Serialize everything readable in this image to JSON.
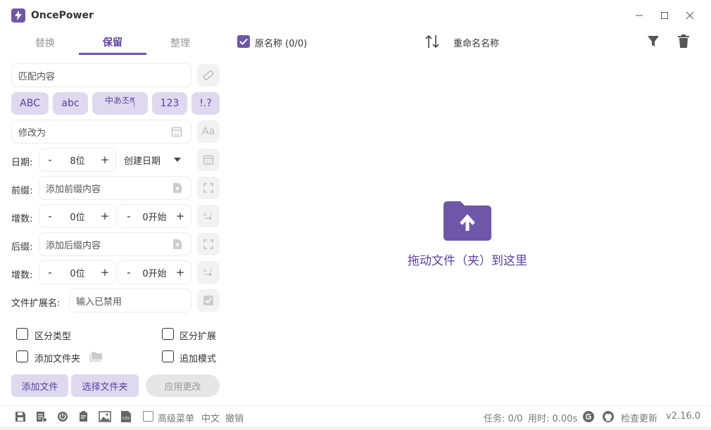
{
  "app": {
    "title": "OncePower",
    "version": "v2.16.0"
  },
  "tabs": [
    {
      "label": "替换",
      "active": false
    },
    {
      "label": "保留",
      "active": true
    },
    {
      "label": "整理",
      "active": false
    }
  ],
  "match": {
    "placeholder": "匹配内容"
  },
  "chips": [
    "ABC",
    "abc",
    "中あ조ན",
    "123",
    "!.?"
  ],
  "modify": {
    "placeholder": "修改为"
  },
  "date": {
    "label": "日期:",
    "digits": "8位",
    "type": "创建日期"
  },
  "prefix": {
    "label": "前缀:",
    "placeholder": "添加前缀内容"
  },
  "prefix_increment": {
    "label": "增数:",
    "digits": "0位",
    "start": "0开始"
  },
  "suffix": {
    "label": "后缀:",
    "placeholder": "添加后缀内容"
  },
  "suffix_increment": {
    "label": "增数:",
    "digits": "0位",
    "start": "0开始"
  },
  "extension": {
    "label": "文件扩展名:",
    "placeholder": "输入已禁用"
  },
  "options": {
    "distinguish_type": "区分类型",
    "distinguish_ext": "区分扩展",
    "add_folder": "添加文件夹",
    "append_mode": "追加模式"
  },
  "buttons": {
    "add_file": "添加文件",
    "select_folder": "选择文件夹",
    "apply": "应用更改"
  },
  "list_header": {
    "original_name": "原名称 (0/0)",
    "rename_name": "重命名名称"
  },
  "drop_zone": {
    "text": "拖动文件（夹）到这里"
  },
  "status": {
    "advanced_menu": "高级菜单",
    "language": "中文",
    "undo": "撤销",
    "tasks": "任务: 0/0",
    "elapsed": "用时: 0.00s",
    "check_update": "检查更新"
  },
  "colors": {
    "accent": "#6e57a8",
    "chip_bg": "#ded9ee"
  }
}
